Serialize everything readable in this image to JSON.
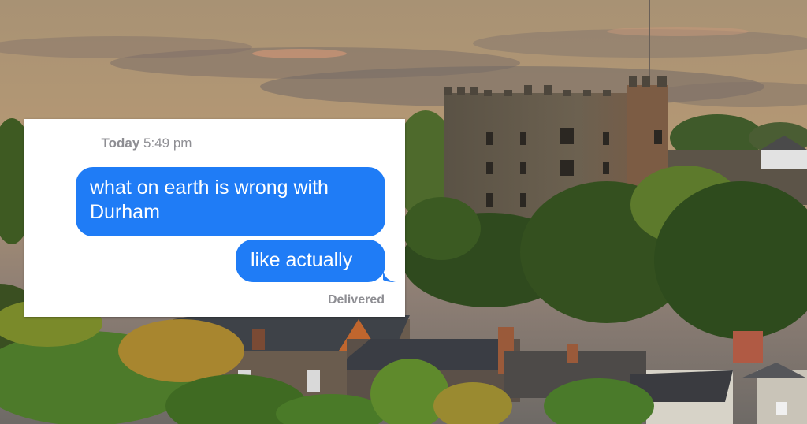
{
  "message_thread": {
    "timestamp_day": "Today",
    "timestamp_time": "5:49 pm",
    "messages": [
      {
        "text": "what on earth is wrong with Durham"
      },
      {
        "text": "like actually"
      }
    ],
    "status": "Delivered"
  },
  "colors": {
    "bubble_blue": "#1f7cf6",
    "meta_gray": "#8e8e93"
  },
  "icons": [
    "castle-photo-background"
  ]
}
